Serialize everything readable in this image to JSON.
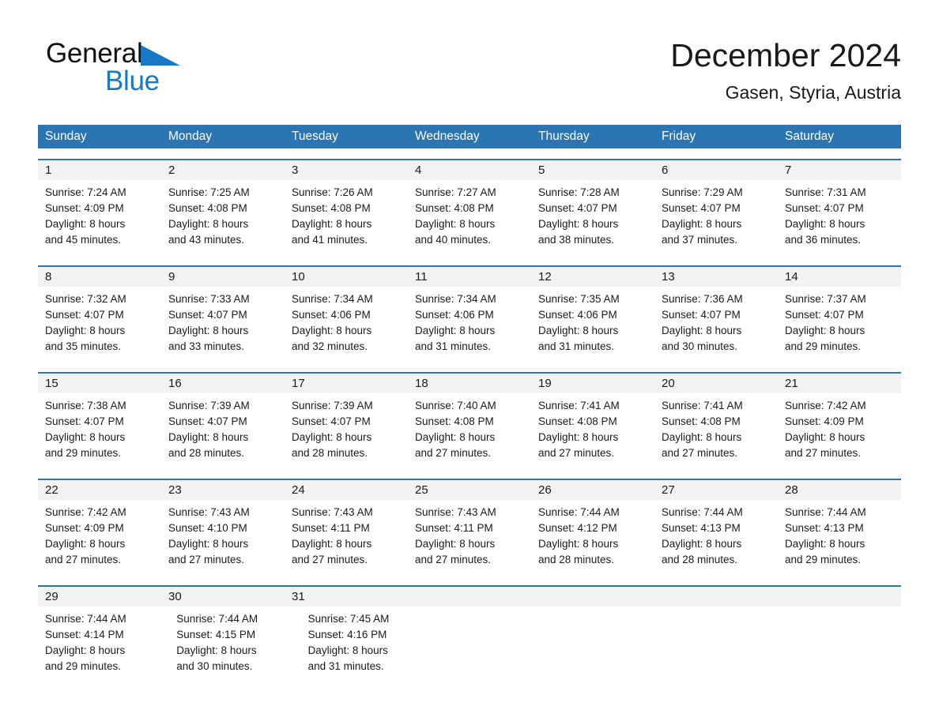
{
  "brand": {
    "name_part1": "General",
    "name_part2": "Blue",
    "logo_icon": "triangle-flag-icon",
    "accent_color": "#1878c4"
  },
  "header": {
    "month_title": "December 2024",
    "location": "Gasen, Styria, Austria"
  },
  "colors": {
    "header_blue": "#2b75b3",
    "daynum_band": "#f2f2f2",
    "text": "#1a1a1a"
  },
  "calendar": {
    "weekday_headers": [
      "Sunday",
      "Monday",
      "Tuesday",
      "Wednesday",
      "Thursday",
      "Friday",
      "Saturday"
    ],
    "weeks": [
      {
        "days": [
          {
            "num": "1",
            "sunrise": "Sunrise: 7:24 AM",
            "sunset": "Sunset: 4:09 PM",
            "daylight1": "Daylight: 8 hours",
            "daylight2": "and 45 minutes."
          },
          {
            "num": "2",
            "sunrise": "Sunrise: 7:25 AM",
            "sunset": "Sunset: 4:08 PM",
            "daylight1": "Daylight: 8 hours",
            "daylight2": "and 43 minutes."
          },
          {
            "num": "3",
            "sunrise": "Sunrise: 7:26 AM",
            "sunset": "Sunset: 4:08 PM",
            "daylight1": "Daylight: 8 hours",
            "daylight2": "and 41 minutes."
          },
          {
            "num": "4",
            "sunrise": "Sunrise: 7:27 AM",
            "sunset": "Sunset: 4:08 PM",
            "daylight1": "Daylight: 8 hours",
            "daylight2": "and 40 minutes."
          },
          {
            "num": "5",
            "sunrise": "Sunrise: 7:28 AM",
            "sunset": "Sunset: 4:07 PM",
            "daylight1": "Daylight: 8 hours",
            "daylight2": "and 38 minutes."
          },
          {
            "num": "6",
            "sunrise": "Sunrise: 7:29 AM",
            "sunset": "Sunset: 4:07 PM",
            "daylight1": "Daylight: 8 hours",
            "daylight2": "and 37 minutes."
          },
          {
            "num": "7",
            "sunrise": "Sunrise: 7:31 AM",
            "sunset": "Sunset: 4:07 PM",
            "daylight1": "Daylight: 8 hours",
            "daylight2": "and 36 minutes."
          }
        ]
      },
      {
        "days": [
          {
            "num": "8",
            "sunrise": "Sunrise: 7:32 AM",
            "sunset": "Sunset: 4:07 PM",
            "daylight1": "Daylight: 8 hours",
            "daylight2": "and 35 minutes."
          },
          {
            "num": "9",
            "sunrise": "Sunrise: 7:33 AM",
            "sunset": "Sunset: 4:07 PM",
            "daylight1": "Daylight: 8 hours",
            "daylight2": "and 33 minutes."
          },
          {
            "num": "10",
            "sunrise": "Sunrise: 7:34 AM",
            "sunset": "Sunset: 4:06 PM",
            "daylight1": "Daylight: 8 hours",
            "daylight2": "and 32 minutes."
          },
          {
            "num": "11",
            "sunrise": "Sunrise: 7:34 AM",
            "sunset": "Sunset: 4:06 PM",
            "daylight1": "Daylight: 8 hours",
            "daylight2": "and 31 minutes."
          },
          {
            "num": "12",
            "sunrise": "Sunrise: 7:35 AM",
            "sunset": "Sunset: 4:06 PM",
            "daylight1": "Daylight: 8 hours",
            "daylight2": "and 31 minutes."
          },
          {
            "num": "13",
            "sunrise": "Sunrise: 7:36 AM",
            "sunset": "Sunset: 4:07 PM",
            "daylight1": "Daylight: 8 hours",
            "daylight2": "and 30 minutes."
          },
          {
            "num": "14",
            "sunrise": "Sunrise: 7:37 AM",
            "sunset": "Sunset: 4:07 PM",
            "daylight1": "Daylight: 8 hours",
            "daylight2": "and 29 minutes."
          }
        ]
      },
      {
        "days": [
          {
            "num": "15",
            "sunrise": "Sunrise: 7:38 AM",
            "sunset": "Sunset: 4:07 PM",
            "daylight1": "Daylight: 8 hours",
            "daylight2": "and 29 minutes."
          },
          {
            "num": "16",
            "sunrise": "Sunrise: 7:39 AM",
            "sunset": "Sunset: 4:07 PM",
            "daylight1": "Daylight: 8 hours",
            "daylight2": "and 28 minutes."
          },
          {
            "num": "17",
            "sunrise": "Sunrise: 7:39 AM",
            "sunset": "Sunset: 4:07 PM",
            "daylight1": "Daylight: 8 hours",
            "daylight2": "and 28 minutes."
          },
          {
            "num": "18",
            "sunrise": "Sunrise: 7:40 AM",
            "sunset": "Sunset: 4:08 PM",
            "daylight1": "Daylight: 8 hours",
            "daylight2": "and 27 minutes."
          },
          {
            "num": "19",
            "sunrise": "Sunrise: 7:41 AM",
            "sunset": "Sunset: 4:08 PM",
            "daylight1": "Daylight: 8 hours",
            "daylight2": "and 27 minutes."
          },
          {
            "num": "20",
            "sunrise": "Sunrise: 7:41 AM",
            "sunset": "Sunset: 4:08 PM",
            "daylight1": "Daylight: 8 hours",
            "daylight2": "and 27 minutes."
          },
          {
            "num": "21",
            "sunrise": "Sunrise: 7:42 AM",
            "sunset": "Sunset: 4:09 PM",
            "daylight1": "Daylight: 8 hours",
            "daylight2": "and 27 minutes."
          }
        ]
      },
      {
        "days": [
          {
            "num": "22",
            "sunrise": "Sunrise: 7:42 AM",
            "sunset": "Sunset: 4:09 PM",
            "daylight1": "Daylight: 8 hours",
            "daylight2": "and 27 minutes."
          },
          {
            "num": "23",
            "sunrise": "Sunrise: 7:43 AM",
            "sunset": "Sunset: 4:10 PM",
            "daylight1": "Daylight: 8 hours",
            "daylight2": "and 27 minutes."
          },
          {
            "num": "24",
            "sunrise": "Sunrise: 7:43 AM",
            "sunset": "Sunset: 4:11 PM",
            "daylight1": "Daylight: 8 hours",
            "daylight2": "and 27 minutes."
          },
          {
            "num": "25",
            "sunrise": "Sunrise: 7:43 AM",
            "sunset": "Sunset: 4:11 PM",
            "daylight1": "Daylight: 8 hours",
            "daylight2": "and 27 minutes."
          },
          {
            "num": "26",
            "sunrise": "Sunrise: 7:44 AM",
            "sunset": "Sunset: 4:12 PM",
            "daylight1": "Daylight: 8 hours",
            "daylight2": "and 28 minutes."
          },
          {
            "num": "27",
            "sunrise": "Sunrise: 7:44 AM",
            "sunset": "Sunset: 4:13 PM",
            "daylight1": "Daylight: 8 hours",
            "daylight2": "and 28 minutes."
          },
          {
            "num": "28",
            "sunrise": "Sunrise: 7:44 AM",
            "sunset": "Sunset: 4:13 PM",
            "daylight1": "Daylight: 8 hours",
            "daylight2": "and 29 minutes."
          }
        ]
      },
      {
        "days": [
          {
            "num": "29",
            "sunrise": "Sunrise: 7:44 AM",
            "sunset": "Sunset: 4:14 PM",
            "daylight1": "Daylight: 8 hours",
            "daylight2": "and 29 minutes."
          },
          {
            "num": "30",
            "sunrise": "Sunrise: 7:44 AM",
            "sunset": "Sunset: 4:15 PM",
            "daylight1": "Daylight: 8 hours",
            "daylight2": "and 30 minutes."
          },
          {
            "num": "31",
            "sunrise": "Sunrise: 7:45 AM",
            "sunset": "Sunset: 4:16 PM",
            "daylight1": "Daylight: 8 hours",
            "daylight2": "and 31 minutes."
          }
        ]
      }
    ]
  }
}
